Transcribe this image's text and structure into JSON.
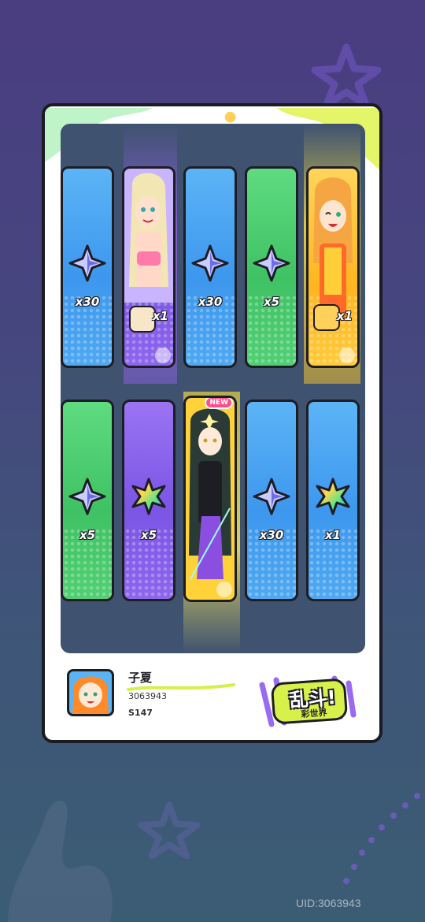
{
  "player": {
    "name": "子夏",
    "uid": "3063943",
    "server": "S147"
  },
  "logo": {
    "main": "乱斗!",
    "sub": "彩世界"
  },
  "tiles": [
    {
      "color": "blue",
      "reward": "crystal-star-icon",
      "qty": "x30"
    },
    {
      "color": "purple",
      "reward": "character-card",
      "qty": "x1"
    },
    {
      "color": "blue",
      "reward": "crystal-star-icon",
      "qty": "x30"
    },
    {
      "color": "green",
      "reward": "crystal-star-icon",
      "qty": "x5"
    },
    {
      "color": "gold",
      "reward": "character-card",
      "qty": "x1"
    },
    {
      "color": "green",
      "reward": "crystal-star-icon",
      "qty": "x5"
    },
    {
      "color": "purple",
      "reward": "rainbow-crystal-icon",
      "qty": "x5"
    },
    {
      "color": "gold",
      "reward": "character-card",
      "badge": "NEW"
    },
    {
      "color": "blue",
      "reward": "crystal-star-icon",
      "qty": "x30"
    },
    {
      "color": "blue",
      "reward": "rainbow-crystal-icon",
      "qty": "x1"
    }
  ],
  "uid_footer": "UID:3063943",
  "colors": {
    "blue": "#3d97ee",
    "green": "#3fc264",
    "purple": "#7b55e4",
    "gold": "#ffb51f",
    "new_badge": "#ff4f8a"
  }
}
